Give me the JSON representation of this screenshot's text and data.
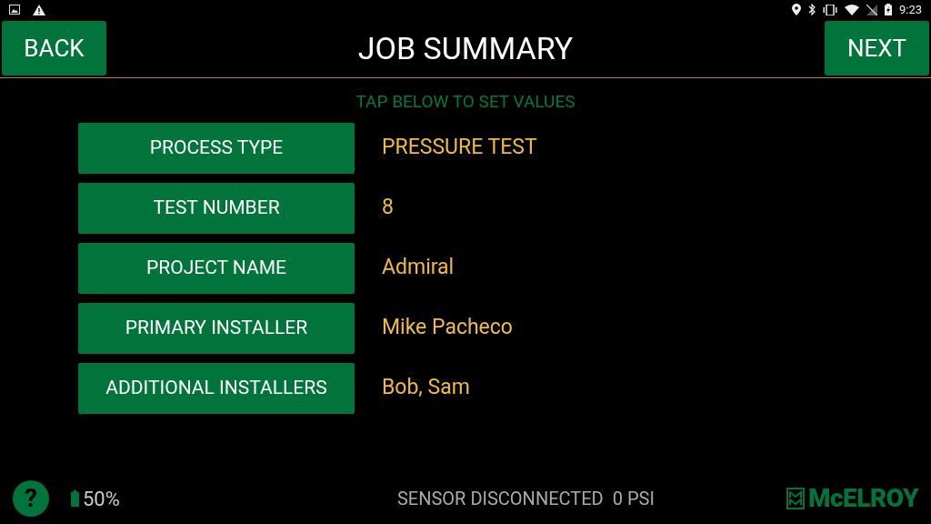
{
  "status_bar": {
    "time": "9:23"
  },
  "header": {
    "back": "BACK",
    "title": "JOB SUMMARY",
    "next": "NEXT"
  },
  "hint": "TAP BELOW TO SET VALUES",
  "fields": [
    {
      "label": "PROCESS TYPE",
      "value": "PRESSURE TEST"
    },
    {
      "label": "TEST NUMBER",
      "value": "8"
    },
    {
      "label": "PROJECT NAME",
      "value": "Admiral"
    },
    {
      "label": "PRIMARY INSTALLER",
      "value": "Mike Pacheco"
    },
    {
      "label": "ADDITIONAL INSTALLERS",
      "value": "Bob, Sam"
    }
  ],
  "footer": {
    "help": "?",
    "battery": "50%",
    "sensor": "SENSOR DISCONNECTED",
    "pressure": "0 PSI",
    "logo": "McELROY"
  }
}
